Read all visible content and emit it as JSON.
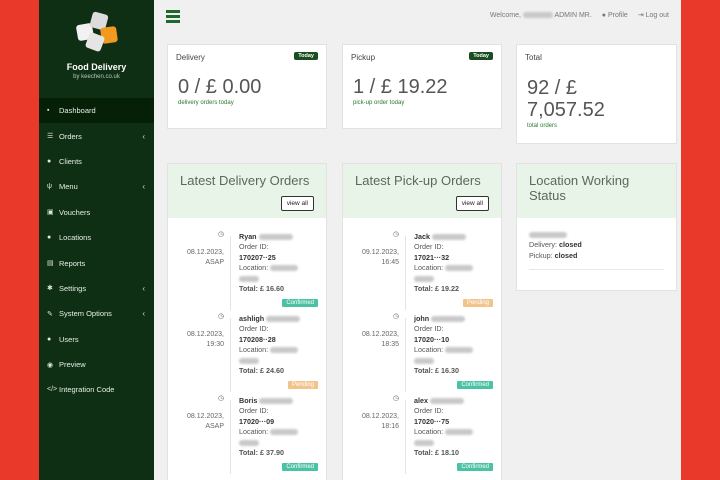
{
  "brand": {
    "title": "Food Delivery",
    "subtitle": "by keechen.co.uk"
  },
  "nav": [
    {
      "label": "Dashboard",
      "icon": "dashboard-icon",
      "glyph": "▪",
      "active": true,
      "chevron": ""
    },
    {
      "label": "Orders",
      "icon": "list-icon",
      "glyph": "☰",
      "chevron": "‹"
    },
    {
      "label": "Clients",
      "icon": "user-icon",
      "glyph": "●",
      "chevron": ""
    },
    {
      "label": "Menu",
      "icon": "fork-knife-icon",
      "glyph": "ψ",
      "chevron": "‹"
    },
    {
      "label": "Vouchers",
      "icon": "gift-icon",
      "glyph": "▣",
      "chevron": ""
    },
    {
      "label": "Locations",
      "icon": "map-marker-icon",
      "glyph": "●",
      "chevron": ""
    },
    {
      "label": "Reports",
      "icon": "copy-icon",
      "glyph": "▤",
      "chevron": ""
    },
    {
      "label": "Settings",
      "icon": "cogs-icon",
      "glyph": "✱",
      "chevron": "‹"
    },
    {
      "label": "System Options",
      "icon": "wrench-icon",
      "glyph": "✎",
      "chevron": "‹"
    },
    {
      "label": "Users",
      "icon": "users-icon",
      "glyph": "●",
      "chevron": ""
    },
    {
      "label": "Preview",
      "icon": "eye-icon",
      "glyph": "◉",
      "chevron": ""
    },
    {
      "label": "Integration Code",
      "icon": "code-icon",
      "glyph": "</>",
      "chevron": ""
    }
  ],
  "topbar": {
    "welcome": "Welcome,",
    "role": "ADMIN MR.",
    "profile": "Profile",
    "logout": "Log out"
  },
  "stats": {
    "delivery": {
      "label": "Delivery",
      "badge": "Today",
      "value": "0 / £ 0.00",
      "sub": "delivery orders today"
    },
    "pickup": {
      "label": "Pickup",
      "badge": "Today",
      "value": "1 / £ 19.22",
      "sub": "pick-up order today"
    },
    "total": {
      "label": "Total",
      "value": "92 / £ 7,057.52",
      "sub": "total orders"
    }
  },
  "delivery_orders": {
    "title": "Latest Delivery Orders",
    "view_all": "view all",
    "items": [
      {
        "date": "08.12.2023,",
        "time": "ASAP",
        "name": "Ryan",
        "order_label": "Order ID:",
        "order_id": "170207··25",
        "location_label": "Location:",
        "total": "Total: £ 16.60",
        "status": "Confirmed",
        "kind": "confirmed"
      },
      {
        "date": "08.12.2023,",
        "time": "19:30",
        "name": "ashligh",
        "order_label": "Order ID:",
        "order_id": "170208··28",
        "location_label": "Location:",
        "total": "Total: £ 24.60",
        "status": "Pending",
        "kind": "pending"
      },
      {
        "date": "08.12.2023,",
        "time": "ASAP",
        "name": "Boris",
        "order_label": "Order ID:",
        "order_id": "17020···09",
        "location_label": "Location:",
        "total": "Total: £ 37.90",
        "status": "Confirmed",
        "kind": "confirmed"
      }
    ]
  },
  "pickup_orders": {
    "title": "Latest Pick-up Orders",
    "view_all": "view all",
    "items": [
      {
        "date": "09.12.2023,",
        "time": "16:45",
        "name": "Jack",
        "order_label": "Order ID:",
        "order_id": "17021···32",
        "location_label": "Location:",
        "total": "Total: £ 19.22",
        "status": "Pending",
        "kind": "pending"
      },
      {
        "date": "08.12.2023,",
        "time": "18:35",
        "name": "john",
        "order_label": "Order ID:",
        "order_id": "17020···10",
        "location_label": "Location:",
        "total": "Total: £ 16.30",
        "status": "Confirmed",
        "kind": "confirmed"
      },
      {
        "date": "08.12.2023,",
        "time": "18:16",
        "name": "alex",
        "order_label": "Order ID:",
        "order_id": "17020···75",
        "location_label": "Location:",
        "total": "Total: £ 18.10",
        "status": "Confirmed",
        "kind": "confirmed"
      }
    ]
  },
  "location_status": {
    "title": "Location Working Status",
    "delivery_label": "Delivery:",
    "delivery_value": "closed",
    "pickup_label": "Pickup:",
    "pickup_value": "closed"
  }
}
